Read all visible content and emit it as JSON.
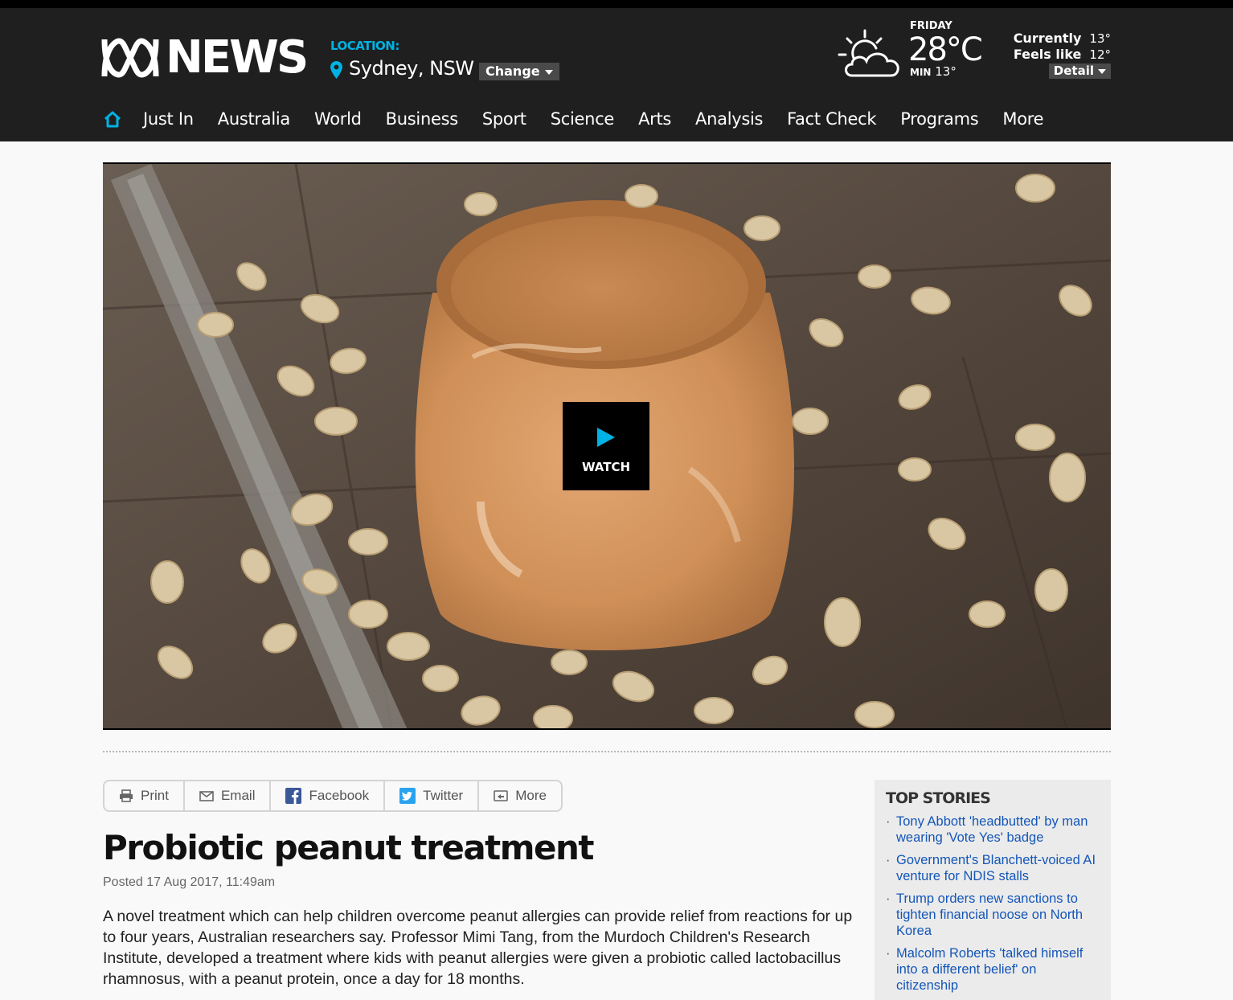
{
  "header": {
    "brand": "NEWS",
    "location_label": "LOCATION:",
    "location_city": "Sydney, NSW",
    "change_label": "Change"
  },
  "weather": {
    "day": "FRIDAY",
    "temp": "28°C",
    "min_label": "MIN",
    "min_value": "13°",
    "currently_label": "Currently",
    "currently_value": "13°",
    "feels_label": "Feels like",
    "feels_value": "12°",
    "detail_label": "Detail",
    "icon": "partly-sunny-icon"
  },
  "nav": {
    "items": [
      "Just In",
      "Australia",
      "World",
      "Business",
      "Sport",
      "Science",
      "Arts",
      "Analysis",
      "Fact Check",
      "Programs",
      "More"
    ],
    "accent": "#00b2e3"
  },
  "video": {
    "watch_label": "WATCH"
  },
  "share": {
    "print": "Print",
    "email": "Email",
    "facebook": "Facebook",
    "twitter": "Twitter",
    "more": "More"
  },
  "article": {
    "title": "Probiotic peanut treatment",
    "posted": "Posted 17 Aug 2017, 11:49am",
    "body": "A novel treatment which can help children overcome peanut allergies can provide relief from reactions for up to four years, Australian researchers say. Professor Mimi Tang, from the Murdoch Children's Research Institute, developed a treatment where kids with peanut allergies were given a probiotic called lactobacillus rhamnosus, with a peanut protein, once a day for 18 months."
  },
  "top_stories": {
    "heading": "TOP STORIES",
    "items": [
      "Tony Abbott 'headbutted' by man wearing 'Vote Yes' badge",
      "Government's Blanchett-voiced AI venture for NDIS stalls",
      "Trump orders new sanctions to tighten financial noose on North Korea",
      "Malcolm Roberts 'talked himself into a different belief' on citizenship"
    ],
    "link_color": "#1456b8"
  }
}
